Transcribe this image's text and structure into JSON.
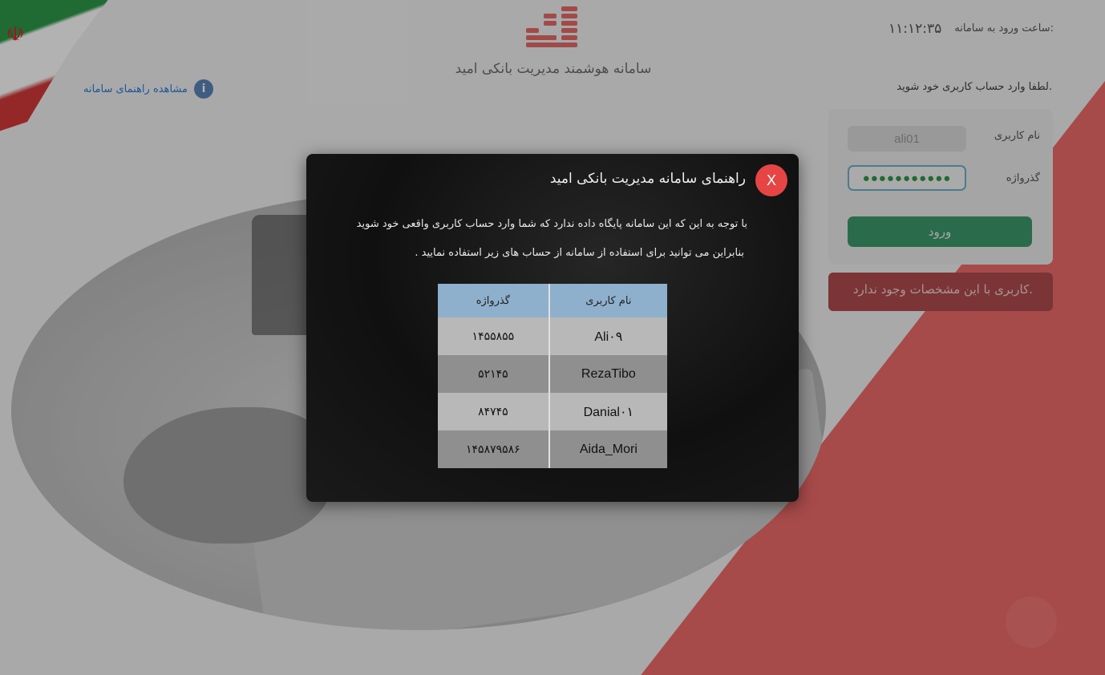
{
  "app": {
    "title": "سامانه هوشمند مدیریت بانکی امید",
    "help_link": "مشاهده راهنمای سامانه"
  },
  "header": {
    "login_time_label": "ساعت ورود به سامانه:",
    "login_time_value": "۱۱:۱۲:۳۵",
    "login_prompt": "لطفا وارد حساب کاربری خود شوید."
  },
  "login_form": {
    "username_label": "نام کاربری",
    "username_value": "ali01",
    "password_label": "گذرواژه",
    "password_value": "●●●●●●●●●●●",
    "submit_label": "ورود"
  },
  "error": {
    "message": "کاربری با این مشخصات وجود ندارد."
  },
  "modal": {
    "title": "راهنمای سامانه مدیریت بانکی امید",
    "close_label": "X",
    "line1": "با توجه به این که این سامانه پایگاه داده ندارد که شما وارد حساب کاربری واقعی خود شوید",
    "line2": "بنابراین می توانید برای استفاده از سامانه از حساب های زیر استفاده نمایید .",
    "table": {
      "col_username": "نام کاربری",
      "col_password": "گذرواژه",
      "rows": [
        {
          "username": "Ali۰۹",
          "password": "۱۴۵۵۸۵۵"
        },
        {
          "username": "RezaTibo",
          "password": "۵۲۱۴۵"
        },
        {
          "username": "Danial۰۱",
          "password": "۸۴۷۴۵"
        },
        {
          "username": "Aida_Mori",
          "password": "۱۴۵۸۷۹۵۸۶"
        }
      ]
    }
  },
  "colors": {
    "accent_red": "#f06b6b",
    "login_button": "#3b9a6b",
    "error_bg": "#b24d4f",
    "link_blue": "#2c7bd6",
    "table_header": "#8fb0cc"
  },
  "icons": {
    "help": "info-icon",
    "close": "close-icon",
    "logo": "bars-logo-icon",
    "flag": "iran-flag-icon"
  }
}
